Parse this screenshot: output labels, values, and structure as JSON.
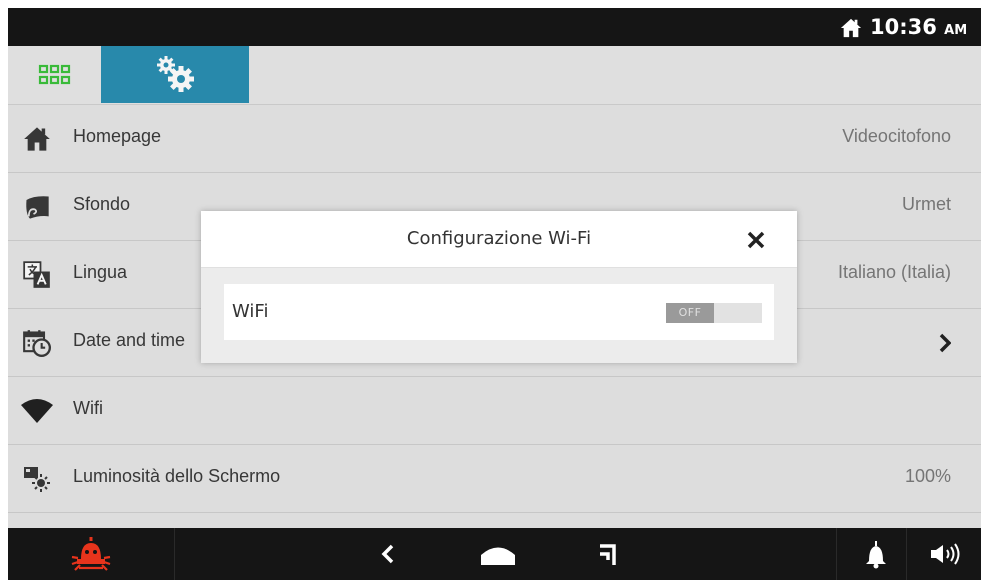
{
  "status_bar": {
    "time": "10:36",
    "ampm": "AM",
    "home_icon": "home-icon"
  },
  "tabs": [
    {
      "icon": "apps-grid-icon",
      "active": false
    },
    {
      "icon": "settings-gears-icon",
      "active": true
    }
  ],
  "settings": [
    {
      "label": "Homepage",
      "value": "Videocitofono",
      "icon": "home-icon"
    },
    {
      "label": "Sfondo",
      "value": "Urmet",
      "icon": "wallpaper-icon"
    },
    {
      "label": "Lingua",
      "value": "Italiano (Italia)",
      "icon": "language-icon"
    },
    {
      "label": "Date and time",
      "value": "",
      "icon": "calendar-clock-icon"
    },
    {
      "label": "Wifi",
      "value": "",
      "icon": "wifi-icon"
    },
    {
      "label": "Luminosità dello Schermo",
      "value": "100%",
      "icon": "brightness-icon"
    }
  ],
  "dialog": {
    "title": "Configurazione Wi-Fi",
    "wifi_label": "WiFi",
    "toggle_state": "OFF"
  },
  "nav_bar": {
    "icons": [
      "alarm-icon",
      "back-icon",
      "home-icon",
      "recent-apps-icon",
      "bell-icon",
      "volume-icon"
    ]
  },
  "colors": {
    "accent": "#2a8fb2",
    "alarm": "#e8341c",
    "apps_grid": "#3cc23c"
  }
}
